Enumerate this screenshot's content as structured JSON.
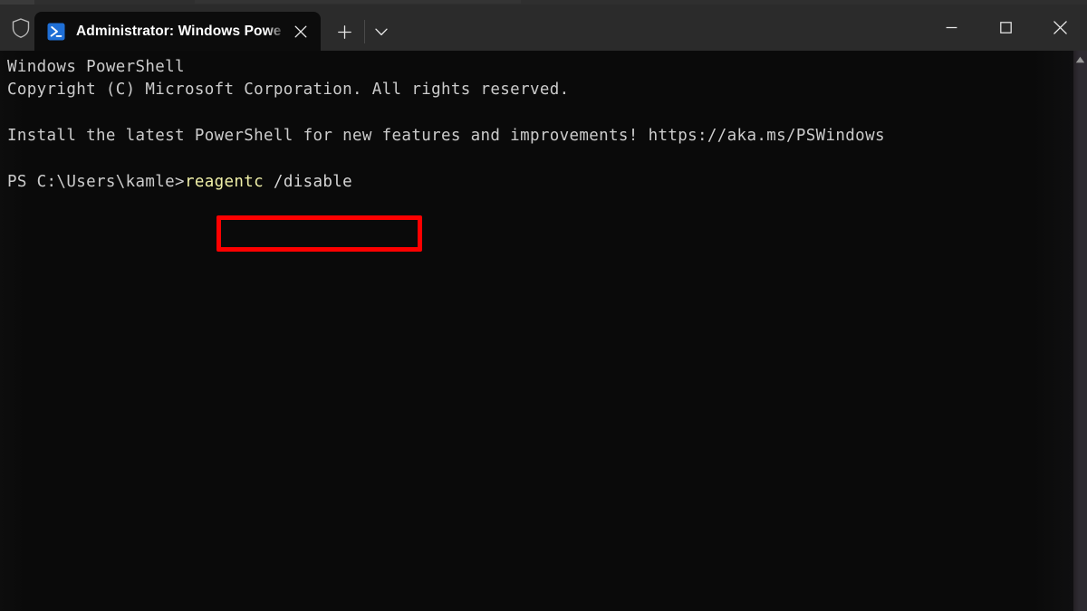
{
  "window": {
    "titlebar": {
      "admin_shield_icon": "shield-icon",
      "tab": {
        "icon": "powershell-icon",
        "title": "Administrator: Windows Powe",
        "close_label": "✕"
      },
      "new_tab_label": "+",
      "dropdown_label": "⌄",
      "controls": {
        "minimize_label": "—",
        "maximize_label": "□",
        "close_label": "✕"
      }
    },
    "colors": {
      "titlebar_bg": "#2b2b2b",
      "terminal_bg": "#0c0c0c",
      "terminal_fg": "#cccccc",
      "accent_highlight": "#fe0000",
      "powershell_blue": "#1e6fd9",
      "command_token": "#f0f0a8"
    }
  },
  "terminal": {
    "lines": [
      "Windows PowerShell",
      "Copyright (C) Microsoft Corporation. All rights reserved.",
      "",
      "Install the latest PowerShell for new features and improvements! https://aka.ms/PSWindows",
      "",
      "PS C:\\Users\\kamle>"
    ],
    "banner_title": "Windows PowerShell",
    "banner_copyright": "Copyright (C) Microsoft Corporation. All rights reserved.",
    "update_notice": "Install the latest PowerShell for new features and improvements! https://aka.ms/PSWindows",
    "update_url": "https://aka.ms/PSWindows",
    "prompt": "PS C:\\Users\\kamle>",
    "command": {
      "executable": "reagentc",
      "argument": " /disable",
      "full": "reagentc /disable",
      "highlighted": true
    }
  },
  "scrollbar": {
    "up_arrow_label": "▲"
  }
}
